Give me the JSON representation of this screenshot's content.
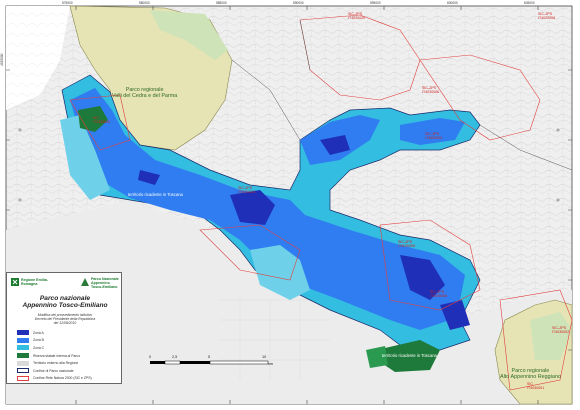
{
  "legend": {
    "logo_left": "Regione Emilia-Romagna",
    "logo_right": "Parco Nazionale Appennino Tosco-Emiliano",
    "title_line1": "Parco nazionale",
    "title_line2": "Appennino Tosco-Emiliano",
    "subtitle_line1": "Modifica dei provvedimento istitutivo",
    "subtitle_line2": "Decreto del Presidente della Repubblica",
    "subtitle_line3": "del 12/08/2010",
    "items": [
      {
        "label": "Zona A",
        "color": "#1f2fb8"
      },
      {
        "label": "Zona B",
        "color": "#2f7df0"
      },
      {
        "label": "Zona C",
        "color": "#33bde0"
      },
      {
        "label": "Riserva statale interna al Parco",
        "color": "#1e7a3a"
      },
      {
        "label": "Territorio esterno alla Regione",
        "color": "#d9d9d9"
      },
      {
        "label": "Confine di Parco nazionale",
        "color": "#1a2a6a"
      },
      {
        "label": "Confine Rete Natura 2000 (SIC e ZPS)",
        "color": "#e04040"
      }
    ]
  },
  "labels": {
    "park_parma_line1": "Parco regionale",
    "park_parma_line2": "Valli del Cedra e del Parma",
    "park_alto_line1": "Parco regionale",
    "park_alto_line2": "Alto Appennino Reggiano",
    "tuscany_1": "territorio ricadente in Toscana",
    "tuscany_2": "territorio ricadente in Toscana"
  },
  "natura_codes": [
    {
      "line1": "SIC-ZPS",
      "line2": "IT4020020"
    },
    {
      "line1": "SIC-ZPS",
      "line2": "IT4020008"
    },
    {
      "line1": "SIC",
      "line2": "IT4030003"
    },
    {
      "line1": "SIC-ZPS",
      "line2": "IT4030006"
    },
    {
      "line1": "SIC-ZPS",
      "line2": "IT4030004"
    },
    {
      "line1": "SIC-ZPS",
      "line2": "IT4030013"
    },
    {
      "line1": "SIC-ZPS",
      "line2": "IT4030005"
    },
    {
      "line1": "SIC-ZPS",
      "line2": "IT4030008"
    },
    {
      "line1": "SIC-ZPS",
      "line2": "IT4030002"
    },
    {
      "line1": "SIC",
      "line2": "IT4040001"
    }
  ],
  "scale": {
    "labels": [
      "0",
      "2,5",
      "5",
      "10"
    ],
    "unit": "km"
  },
  "ticks_top": [
    "575000",
    "580000",
    "585000",
    "590000",
    "595000",
    "600000",
    "605000",
    "610000"
  ],
  "ticks_left": [
    "4925000",
    "4920000",
    "4915000",
    "4910000",
    "4905000"
  ]
}
